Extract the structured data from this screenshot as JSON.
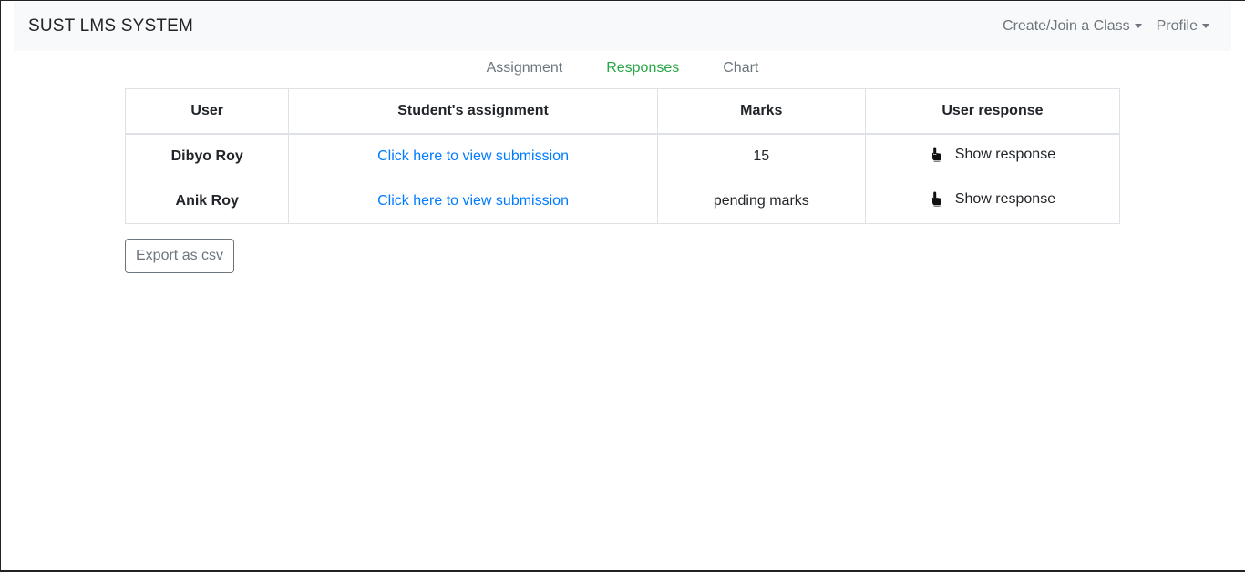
{
  "navbar": {
    "brand": "SUST LMS SYSTEM",
    "menus": [
      {
        "label": "Create/Join a Class"
      },
      {
        "label": "Profile"
      }
    ]
  },
  "tabs": [
    {
      "label": "Assignment",
      "active": false
    },
    {
      "label": "Responses",
      "active": true
    },
    {
      "label": "Chart",
      "active": false
    }
  ],
  "table": {
    "headers": [
      "User",
      "Student's assignment",
      "Marks",
      "User response"
    ],
    "rows": [
      {
        "user": "Dibyo Roy",
        "assignment_link": "Click here to view submission",
        "marks": "15",
        "response_label": "Show response",
        "response_icon": "hand-pointer-icon"
      },
      {
        "user": "Anik Roy",
        "assignment_link": "Click here to view submission",
        "marks": "pending marks",
        "response_label": "Show response",
        "response_icon": "hand-pointer-icon"
      }
    ]
  },
  "actions": {
    "export_label": "Export as csv"
  },
  "colors": {
    "active_tab": "#28a745",
    "link": "#007bff",
    "muted": "#6c757d",
    "navbar_bg": "#f8f9fa"
  }
}
